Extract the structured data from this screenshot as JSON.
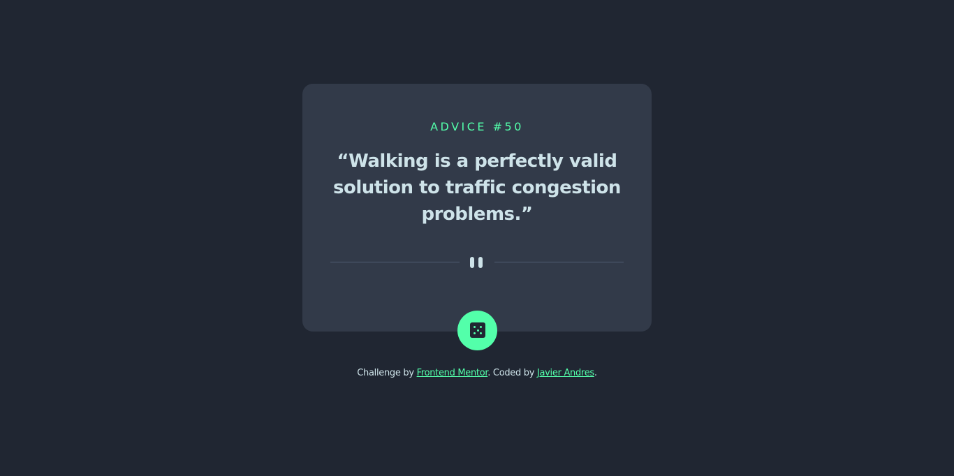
{
  "advice": {
    "label": "ADVICE #50",
    "quote": "“Walking is a perfectly valid solution to traffic congestion problems.”"
  },
  "icons": {
    "divider": "pause-icon",
    "button": "dice-icon"
  },
  "colors": {
    "background": "#202632",
    "card": "#323a49",
    "accent": "#53ffaa",
    "text": "#cee3e9",
    "divider": "#4f5d74"
  },
  "footer": {
    "prefix": "Challenge by ",
    "link1": "Frontend Mentor",
    "middle": ". Coded by ",
    "link2": "Javier Andres",
    "suffix": "."
  }
}
